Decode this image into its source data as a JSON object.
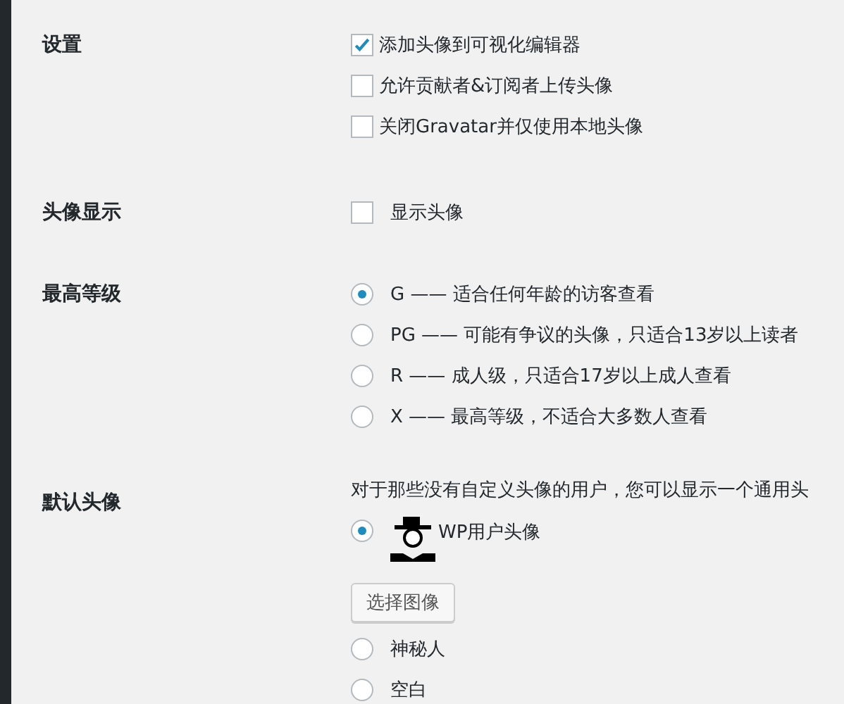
{
  "sections": [
    {
      "label": "设置",
      "items": [
        {
          "kind": "checkbox",
          "text": "添加头像到可视化编辑器",
          "checked": true
        },
        {
          "kind": "checkbox",
          "text": "允许贡献者&订阅者上传头像",
          "checked": false
        },
        {
          "kind": "checkbox",
          "text": "关闭Gravatar并仅使用本地头像",
          "checked": false
        }
      ]
    },
    {
      "label": "头像显示",
      "items": [
        {
          "kind": "checkbox",
          "text": "显示头像",
          "checked": false
        }
      ]
    },
    {
      "label": "最高等级",
      "items": [
        {
          "kind": "radio",
          "text": "G —— 适合任何年龄的访客查看",
          "selected": true
        },
        {
          "kind": "radio",
          "text": "PG —— 可能有争议的头像，只适合13岁以上读者",
          "selected": false
        },
        {
          "kind": "radio",
          "text": "R —— 成人级，只适合17岁以上成人查看",
          "selected": false
        },
        {
          "kind": "radio",
          "text": "X —— 最高等级，不适合大多数人查看",
          "selected": false
        }
      ]
    },
    {
      "label": "默认头像",
      "items": [
        {
          "kind": "description",
          "text": "对于那些没有自定义头像的用户，您可以显示一个通用头"
        },
        {
          "kind": "avatar-radio",
          "text": "WP用户头像",
          "selected": true
        },
        {
          "kind": "button",
          "text": "选择图像"
        },
        {
          "kind": "radio",
          "text": "神秘人",
          "selected": false
        },
        {
          "kind": "radio",
          "text": "空白",
          "selected": false
        }
      ]
    }
  ]
}
